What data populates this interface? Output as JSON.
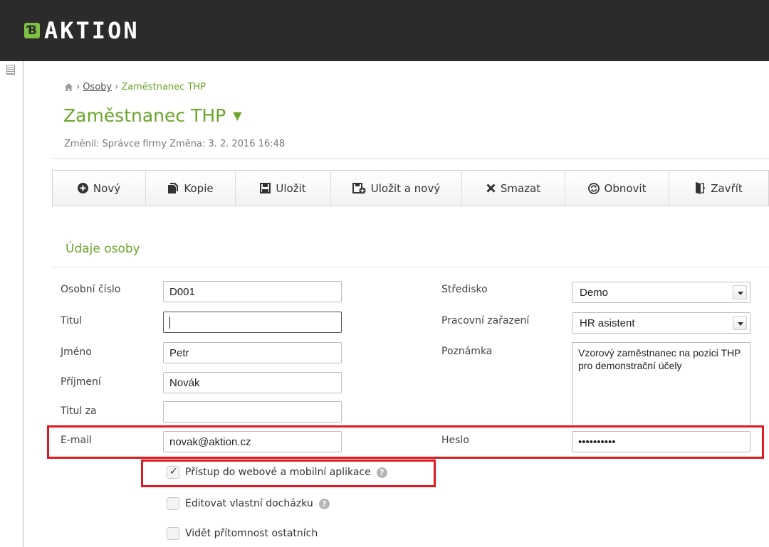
{
  "brand": {
    "logo_text": "AKTION",
    "logo_mark": "Ɓ"
  },
  "breadcrumb": {
    "link": "Osoby",
    "current": "Zaměstnanec THP",
    "separator": "›"
  },
  "page": {
    "title": "Zaměstnanec THP",
    "changed": "Změnil: Správce firmy Změna: 3. 2. 2016 16:48"
  },
  "toolbar": {
    "new": "Nový",
    "copy": "Kopie",
    "save": "Uložit",
    "save_new": "Uložit a nový",
    "delete": "Smazat",
    "refresh": "Obnovit",
    "close": "Zavřít"
  },
  "section": {
    "title": "Údaje osoby"
  },
  "form": {
    "personal_number": {
      "label": "Osobní číslo",
      "value": "D001"
    },
    "title": {
      "label": "Titul",
      "value": ""
    },
    "first_name": {
      "label": "Jméno",
      "value": "Petr"
    },
    "last_name": {
      "label": "Příjmení",
      "value": "Novák"
    },
    "title_after": {
      "label": "Titul za",
      "value": ""
    },
    "email": {
      "label": "E-mail",
      "value": "novak@aktion.cz"
    },
    "center": {
      "label": "Středisko",
      "value": "Demo"
    },
    "position": {
      "label": "Pracovní zařazení",
      "value": "HR asistent"
    },
    "note": {
      "label": "Poznámka",
      "value": "Vzorový zaměstnanec na pozici THP pro demonstrační účely"
    },
    "password": {
      "label": "Heslo",
      "value": "••••••••••"
    }
  },
  "checkboxes": {
    "web_access": {
      "label": "Přístup do webové a mobilní aplikace",
      "checked": true
    },
    "edit_attendance": {
      "label": "Editovat vlastní docházku",
      "checked": false
    },
    "see_presence": {
      "label": "Vidět přítomnost ostatních",
      "checked": false
    }
  },
  "colors": {
    "accent": "#6aa52b",
    "highlight": "#e0191f",
    "header": "#2b2b2b"
  },
  "icons": [
    "home-icon",
    "plus-circle-icon",
    "copy-icon",
    "save-icon",
    "save-new-icon",
    "close-x-icon",
    "refresh-icon",
    "exit-door-icon",
    "help-icon",
    "chevron-down-icon"
  ]
}
